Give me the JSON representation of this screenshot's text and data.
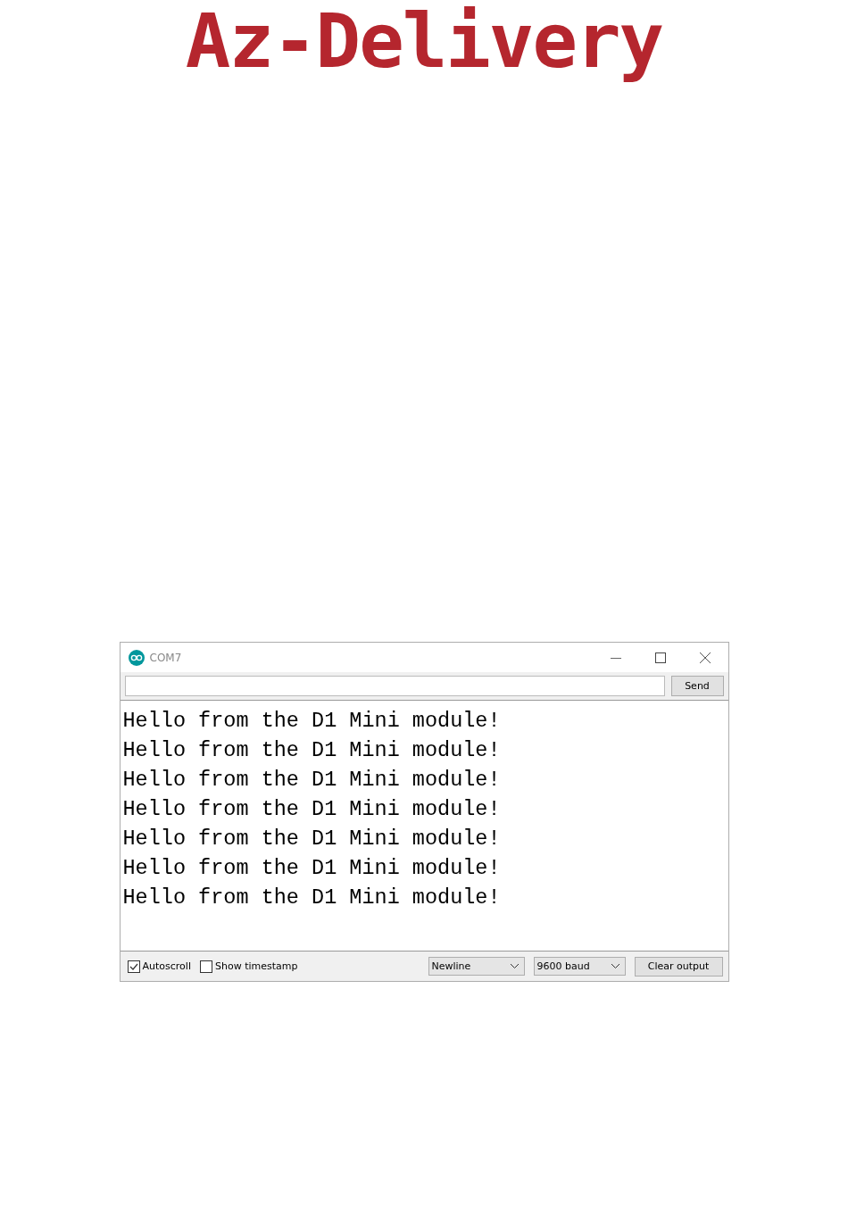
{
  "logo": {
    "text": "Az-Delivery"
  },
  "window": {
    "title": "COM7",
    "send_button": "Send",
    "output_lines": [
      "Hello from the D1 Mini module!",
      "Hello from the D1 Mini module!",
      "Hello from the D1 Mini module!",
      "Hello from the D1 Mini module!",
      "Hello from the D1 Mini module!",
      "Hello from the D1 Mini module!",
      "Hello from the D1 Mini module!"
    ],
    "checkboxes": [
      {
        "label": "Autoscroll",
        "checked": true
      },
      {
        "label": "Show timestamp",
        "checked": false
      }
    ],
    "line_ending": "Newline",
    "baud": "9600 baud",
    "clear_button": "Clear output"
  }
}
